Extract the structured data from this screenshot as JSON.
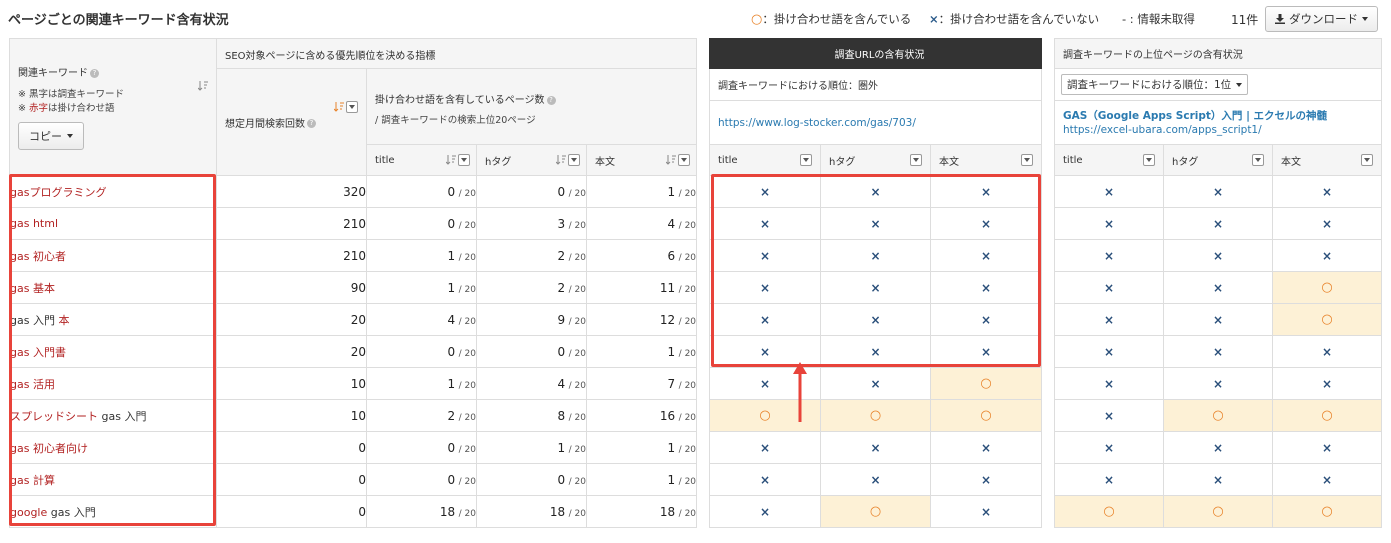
{
  "header": {
    "title": "ページごとの関連キーワード含有状況",
    "legend_contains": "：掛け合わせ語を含んでいる",
    "legend_not_contains": "：掛け合わせ語を含んでいない",
    "legend_no_data": "- : 情報未取得",
    "legend_symbol_o": "○",
    "legend_symbol_x": "×",
    "count": "11件",
    "download_label": "ダウンロード"
  },
  "left_panel": {
    "kw_header": "関連キーワード",
    "kw_note_black": "※ 黒字は調査キーワード",
    "kw_note_red_prefix": "※ ",
    "kw_note_red": "赤字",
    "kw_note_red_suffix": "は掛け合わせ語",
    "copy_label": "コピー",
    "seo_header": "SEO対象ページに含める優先順位を決める指標",
    "volume_header": "想定月間検索回数",
    "contain_header": "掛け合わせ語を含有しているページ数",
    "contain_sub": "/ 調査キーワードの検索上位20ページ",
    "col_title": "title",
    "col_h": "hタグ",
    "col_body": "本文",
    "denominator": "/ 20"
  },
  "mid_panel": {
    "header": "調査URLの含有状況",
    "rank_label": "調査キーワードにおける順位：圏外",
    "url": "https://www.log-stocker.com/gas/703/",
    "col_title": "title",
    "col_h": "hタグ",
    "col_body": "本文"
  },
  "right_panel": {
    "header": "調査キーワードの上位ページの含有状況",
    "rank_select": "調査キーワードにおける順位：1位",
    "page_title": "GAS（Google Apps Script）入門 | エクセルの神髄",
    "url": "https://excel-ubara.com/apps_script1/",
    "col_title": "title",
    "col_h": "hタグ",
    "col_body": "本文"
  },
  "rows": [
    {
      "kw_red": "gasプログラミング",
      "kw_black": "",
      "kw_red2": "",
      "volume": "320",
      "title": "0",
      "h": "0",
      "body": "1",
      "mid": [
        "x",
        "x",
        "x"
      ],
      "right": [
        "x",
        "x",
        "x"
      ]
    },
    {
      "kw_red": "gas html",
      "kw_black": "",
      "kw_red2": "",
      "volume": "210",
      "title": "0",
      "h": "3",
      "body": "4",
      "mid": [
        "x",
        "x",
        "x"
      ],
      "right": [
        "x",
        "x",
        "x"
      ]
    },
    {
      "kw_red": "gas 初心者",
      "kw_black": "",
      "kw_red2": "",
      "volume": "210",
      "title": "1",
      "h": "2",
      "body": "6",
      "mid": [
        "x",
        "x",
        "x"
      ],
      "right": [
        "x",
        "x",
        "x"
      ]
    },
    {
      "kw_red": "gas 基本",
      "kw_black": "",
      "kw_red2": "",
      "volume": "90",
      "title": "1",
      "h": "2",
      "body": "11",
      "mid": [
        "x",
        "x",
        "x"
      ],
      "right": [
        "x",
        "x",
        "o"
      ]
    },
    {
      "kw_red": "",
      "kw_black": "gas 入門 ",
      "kw_red2": "本",
      "volume": "20",
      "title": "4",
      "h": "9",
      "body": "12",
      "mid": [
        "x",
        "x",
        "x"
      ],
      "right": [
        "x",
        "x",
        "o"
      ]
    },
    {
      "kw_red": "gas 入門書",
      "kw_black": "",
      "kw_red2": "",
      "volume": "20",
      "title": "0",
      "h": "0",
      "body": "1",
      "mid": [
        "x",
        "x",
        "x"
      ],
      "right": [
        "x",
        "x",
        "x"
      ]
    },
    {
      "kw_red": "gas 活用",
      "kw_black": "",
      "kw_red2": "",
      "volume": "10",
      "title": "1",
      "h": "4",
      "body": "7",
      "mid": [
        "x",
        "x",
        "o"
      ],
      "right": [
        "x",
        "x",
        "x"
      ]
    },
    {
      "kw_red": "スプレッドシート",
      "kw_black": " gas 入門",
      "kw_red2": "",
      "volume": "10",
      "title": "2",
      "h": "8",
      "body": "16",
      "mid": [
        "o",
        "o",
        "o"
      ],
      "right": [
        "x",
        "o",
        "o"
      ]
    },
    {
      "kw_red": "gas 初心者向け",
      "kw_black": "",
      "kw_red2": "",
      "volume": "0",
      "title": "0",
      "h": "1",
      "body": "1",
      "mid": [
        "x",
        "x",
        "x"
      ],
      "right": [
        "x",
        "x",
        "x"
      ]
    },
    {
      "kw_red": "gas 計算",
      "kw_black": "",
      "kw_red2": "",
      "volume": "0",
      "title": "0",
      "h": "0",
      "body": "1",
      "mid": [
        "x",
        "x",
        "x"
      ],
      "right": [
        "x",
        "x",
        "x"
      ]
    },
    {
      "kw_red": "google",
      "kw_black": " gas 入門",
      "kw_red2": "",
      "volume": "0",
      "title": "18",
      "h": "18",
      "body": "18",
      "mid": [
        "x",
        "o",
        "x"
      ],
      "right": [
        "o",
        "o",
        "o"
      ]
    }
  ],
  "symbols": {
    "o": "○",
    "x": "×"
  },
  "colors": {
    "accent_red": "#e8433a",
    "keyword_red": "#b22222",
    "link_blue": "#2a7ab0",
    "highlight": "#fdf1d6",
    "dark_header": "#333333"
  }
}
